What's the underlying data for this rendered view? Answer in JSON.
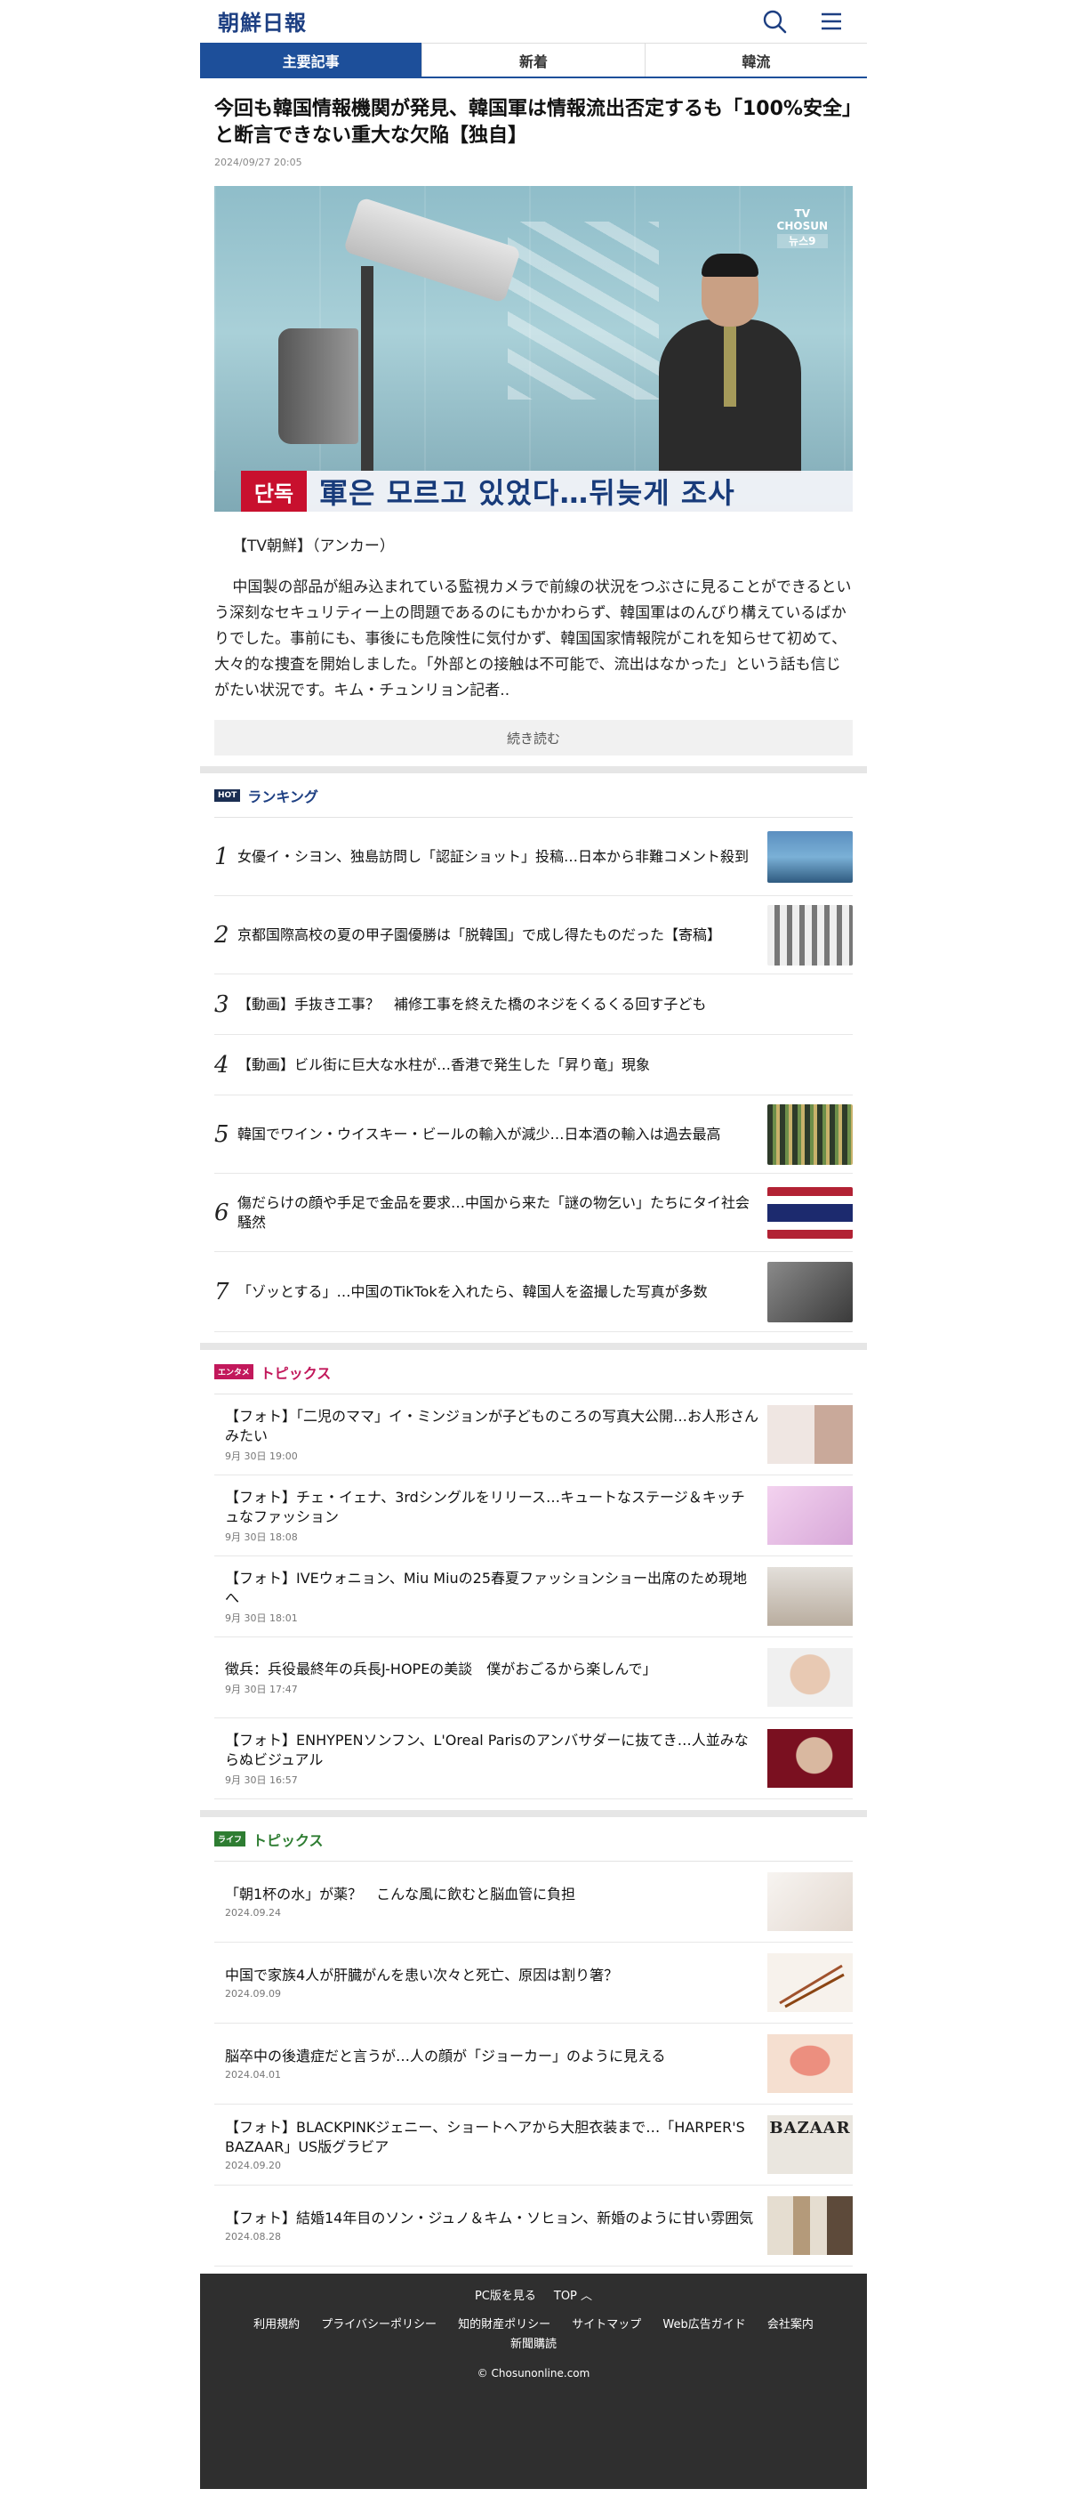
{
  "header": {
    "logo": "朝鮮日報",
    "search_icon": "search-icon",
    "menu_icon": "hamburger-menu-icon"
  },
  "tabs": [
    {
      "label": "主要記事",
      "active": true
    },
    {
      "label": "新着",
      "active": false
    },
    {
      "label": "韓流",
      "active": false
    }
  ],
  "article": {
    "headline": "今回も韓国情報機関が発見、韓国軍は情報流出否定するも「100%安全」と断言できない重大な欠陥【独自】",
    "date": "2024/09/27 20:05",
    "image": {
      "channel_line1": "TV",
      "channel_line2": "CHOSUN",
      "channel_line3": "뉴스9",
      "caption_tag": "단독",
      "caption_text": "軍은 모르고 있었다…뒤늦게 조사"
    },
    "byline": "【TV朝鮮】（アンカー）",
    "body": "中国製の部品が組み込まれている監視カメラで前線の状況をつぶさに見ることができるという深刻なセキュリティー上の問題であるのにもかかわらず、韓国軍はのんびり構えているばかりでした。事前にも、事後にも危険性に気付かず、韓国国家情報院がこれを知らせて初めて、大々的な捜査を開始しました。「外部との接触は不可能で、流出はなかった」という話も信じがたい状況です。キム・チュンリョン記者..",
    "more_label": "続き読む"
  },
  "ranking": {
    "badge": "HOT",
    "title": "ランキング",
    "items": [
      {
        "num": "1",
        "title": "女優イ・シヨン、独島訪問し「認証ショット」投稿…日本から非難コメント殺到",
        "thumb": "islands-photo",
        "color": "#4a7ba3"
      },
      {
        "num": "2",
        "title": "京都国際高校の夏の甲子園優勝は「脱韓国」で成し得たものだった【寄稿】",
        "thumb": "baseball-team-photo",
        "color": "#8c8c8c"
      },
      {
        "num": "3",
        "title": "【動画】手抜き工事？　補修工事を終えた橋のネジをくるくる回す子ども",
        "thumb": "",
        "color": ""
      },
      {
        "num": "4",
        "title": "【動画】ビル街に巨大な水柱が…香港で発生した「昇り竜」現象",
        "thumb": "",
        "color": ""
      },
      {
        "num": "5",
        "title": "韓国でワイン・ウイスキー・ビールの輸入が減少…日本酒の輸入は過去最高",
        "thumb": "liquor-shelf-photo",
        "color": "#3d4a3a"
      },
      {
        "num": "6",
        "title": "傷だらけの顔や手足で金品を要求…中国から来た「謎の物乞い」たちにタイ社会騒然",
        "thumb": "thai-flag-photo",
        "color": "#b22234"
      },
      {
        "num": "7",
        "title": "「ゾッとする」…中国のTikTokを入れたら、韓国人を盗撮した写真が多数",
        "thumb": "tiktok-photo",
        "color": "#555555"
      }
    ]
  },
  "entertainment": {
    "badge": "エンタメ",
    "title": "トピックス",
    "items": [
      {
        "title": "【フォト】「二児のママ」イ・ミンジョンが子どものころの写真大公開…お人形さんみたい",
        "date": "9月 30日 19:00",
        "thumb": "actress-photo",
        "color": "#e8ddd8"
      },
      {
        "title": "【フォト】チェ・イェナ、3rdシングルをリリース…キュートなステージ＆キッチュなファッション",
        "date": "9月 30日 18:08",
        "thumb": "singer-photo",
        "color": "#e9c9e6"
      },
      {
        "title": "【フォト】IVEウォニョン、Miu Miuの25春夏ファッションショー出席のため現地へ",
        "date": "9月 30日 18:01",
        "thumb": "idol-photo",
        "color": "#d9d5cf"
      },
      {
        "title": "徴兵：兵役最終年の兵長J-HOPEの美談　僕がおごるから楽しんで」",
        "date": "9月 30日 17:47",
        "thumb": "soldier-photo",
        "color": "#dcdcdc"
      },
      {
        "title": "【フォト】ENHYPENソンフン、L'Oreal Parisのアンバサダーに抜てき…人並みならぬビジュアル",
        "date": "9月 30日 16:57",
        "thumb": "model-photo",
        "color": "#7a1020"
      }
    ]
  },
  "life": {
    "badge": "ライフ",
    "title": "トピックス",
    "items": [
      {
        "title": "「朝1杯の水」が薬？　こんな風に飲むと脳血管に負担",
        "date": "2024.09.24",
        "thumb": "water-photo",
        "color": "#f0ece8"
      },
      {
        "title": "中国で家族4人が肝臓がんを患い次々と死亡、原因は割り箸？",
        "date": "2024.09.09",
        "thumb": "chopsticks-photo",
        "color": "#f5f0ea"
      },
      {
        "title": "脳卒中の後遺症だと言うが…人の顔が「ジョーカー」のように見える",
        "date": "2024.04.01",
        "thumb": "brain-illustration",
        "color": "#f3d9c7"
      },
      {
        "title": "【フォト】BLACKPINKジェニー、ショートヘアから大胆衣装まで…「HARPER'S BAZAAR」US版グラビア",
        "date": "2024.09.20",
        "thumb": "bazaar-cover",
        "color": "#eae6df",
        "thumb_text": "BAZAAR"
      },
      {
        "title": "【フォト】結婚14年目のソン・ジュノ＆キム・ソヒョン、新婚のように甘い雰囲気",
        "date": "2024.08.28",
        "thumb": "couple-photo",
        "color": "#d9d0c2"
      }
    ]
  },
  "footer": {
    "pc_label": "PC版を見る",
    "top_label": "TOP",
    "links": [
      "利用規約",
      "プライバシーポリシー",
      "知的財産ポリシー",
      "サイトマップ",
      "Web広告ガイド",
      "会社案内",
      "新聞購読"
    ],
    "copyright": "© Chosunonline.com"
  }
}
